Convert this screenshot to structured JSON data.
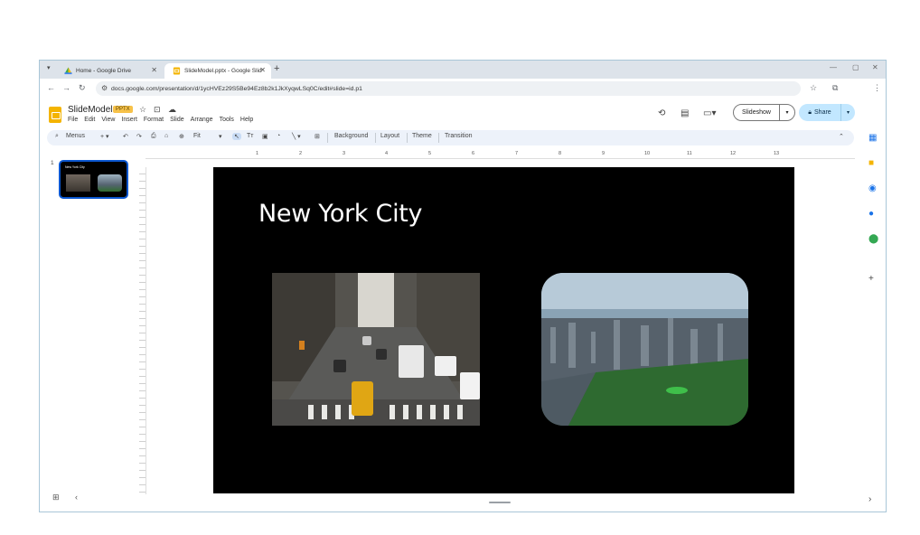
{
  "browser": {
    "tabs": [
      {
        "title": "Home - Google Drive",
        "active": false
      },
      {
        "title": "SlideModel.pptx - Google Slid",
        "active": true
      }
    ],
    "new_tab": "+",
    "url": "docs.google.com/presentation/d/1ycHVEz29S5Be94Ez8b2k1JkXyqwLSq0C/edit#slide=id.p1",
    "window_controls": [
      "—",
      "▢",
      "✕"
    ]
  },
  "docs": {
    "title": "SlideModel",
    "badge": "PPTX",
    "menus": [
      "File",
      "Edit",
      "View",
      "Insert",
      "Format",
      "Slide",
      "Arrange",
      "Tools",
      "Help"
    ],
    "slideshow_label": "Slideshow",
    "share_label": "Share"
  },
  "toolbar": {
    "menus_label": "Menus",
    "zoom": "Fit",
    "background_label": "Background",
    "layout_label": "Layout",
    "theme_label": "Theme",
    "transition_label": "Transition"
  },
  "ruler": {
    "ticks": [
      "1",
      "2",
      "3",
      "4",
      "5",
      "6",
      "7",
      "8",
      "9",
      "10",
      "11",
      "12",
      "13"
    ]
  },
  "filmstrip": {
    "slide_number": "1",
    "thumb_title": "New York City"
  },
  "slide": {
    "title": "New York City"
  },
  "colors": {
    "accent": "#0b57d0",
    "share_bg": "#c2e7ff",
    "slide_bg": "#000000"
  }
}
